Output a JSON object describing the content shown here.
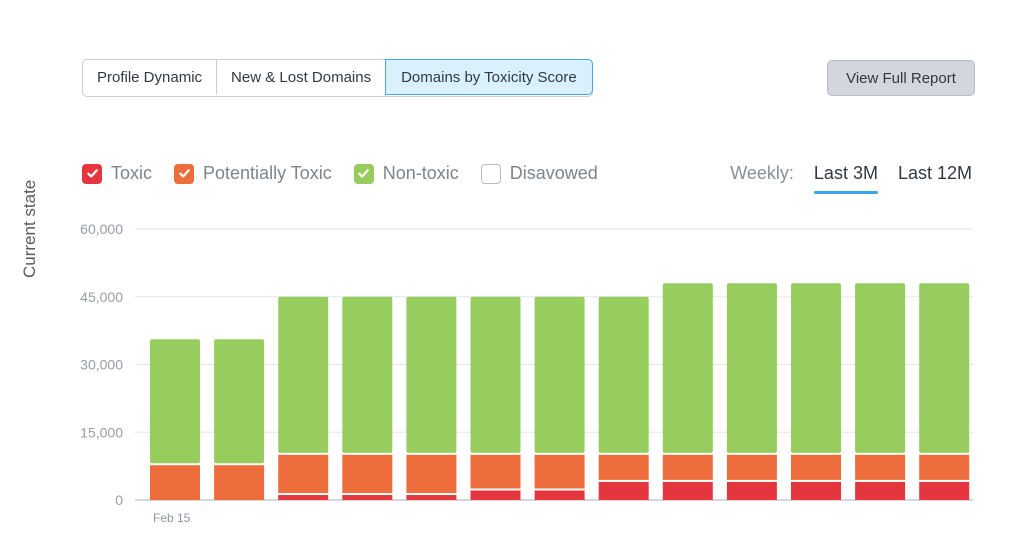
{
  "tabs": [
    {
      "label": "Profile Dynamic",
      "active": false
    },
    {
      "label": "New & Lost Domains",
      "active": false
    },
    {
      "label": "Domains by Toxicity Score",
      "active": true
    }
  ],
  "report_button": "View Full Report",
  "legend": [
    {
      "label": "Toxic",
      "checked": true,
      "color": "#e5363f"
    },
    {
      "label": "Potentially Toxic",
      "checked": true,
      "color": "#ee6d3c"
    },
    {
      "label": "Non-toxic",
      "checked": true,
      "color": "#97cd5e"
    },
    {
      "label": "Disavowed",
      "checked": false,
      "color": "#ffffff"
    }
  ],
  "period": {
    "label": "Weekly:",
    "options": [
      {
        "label": "Last 3M",
        "active": true
      },
      {
        "label": "Last 12M",
        "active": false
      }
    ]
  },
  "chart_data": {
    "type": "bar",
    "stacked": true,
    "title": "",
    "xlabel": "",
    "ylabel": "Current state",
    "ylim": [
      0,
      60000
    ],
    "yticks": [
      0,
      15000,
      30000,
      45000,
      60000
    ],
    "ytick_labels": [
      "0",
      "15,000",
      "30,000",
      "45,000",
      "60,000"
    ],
    "grid": true,
    "categories": [
      "Feb 15",
      "",
      "",
      "",
      "",
      "",
      "",
      "",
      "",
      "",
      "",
      "",
      ""
    ],
    "series": [
      {
        "name": "Toxic",
        "color": "#e5363f",
        "values": [
          0,
          0,
          1100,
          1100,
          1100,
          2100,
          2100,
          4000,
          4000,
          4000,
          4000,
          4000,
          4000
        ]
      },
      {
        "name": "Potentially Toxic",
        "color": "#ee6d3c",
        "values": [
          7700,
          7700,
          8900,
          8900,
          8900,
          7900,
          7900,
          6000,
          6000,
          6000,
          6000,
          6000,
          6000
        ]
      },
      {
        "name": "Non-toxic",
        "color": "#97cd5e",
        "values": [
          27900,
          27900,
          35000,
          35000,
          35000,
          35000,
          35000,
          35000,
          38000,
          38000,
          38000,
          38000,
          38000
        ]
      }
    ]
  }
}
